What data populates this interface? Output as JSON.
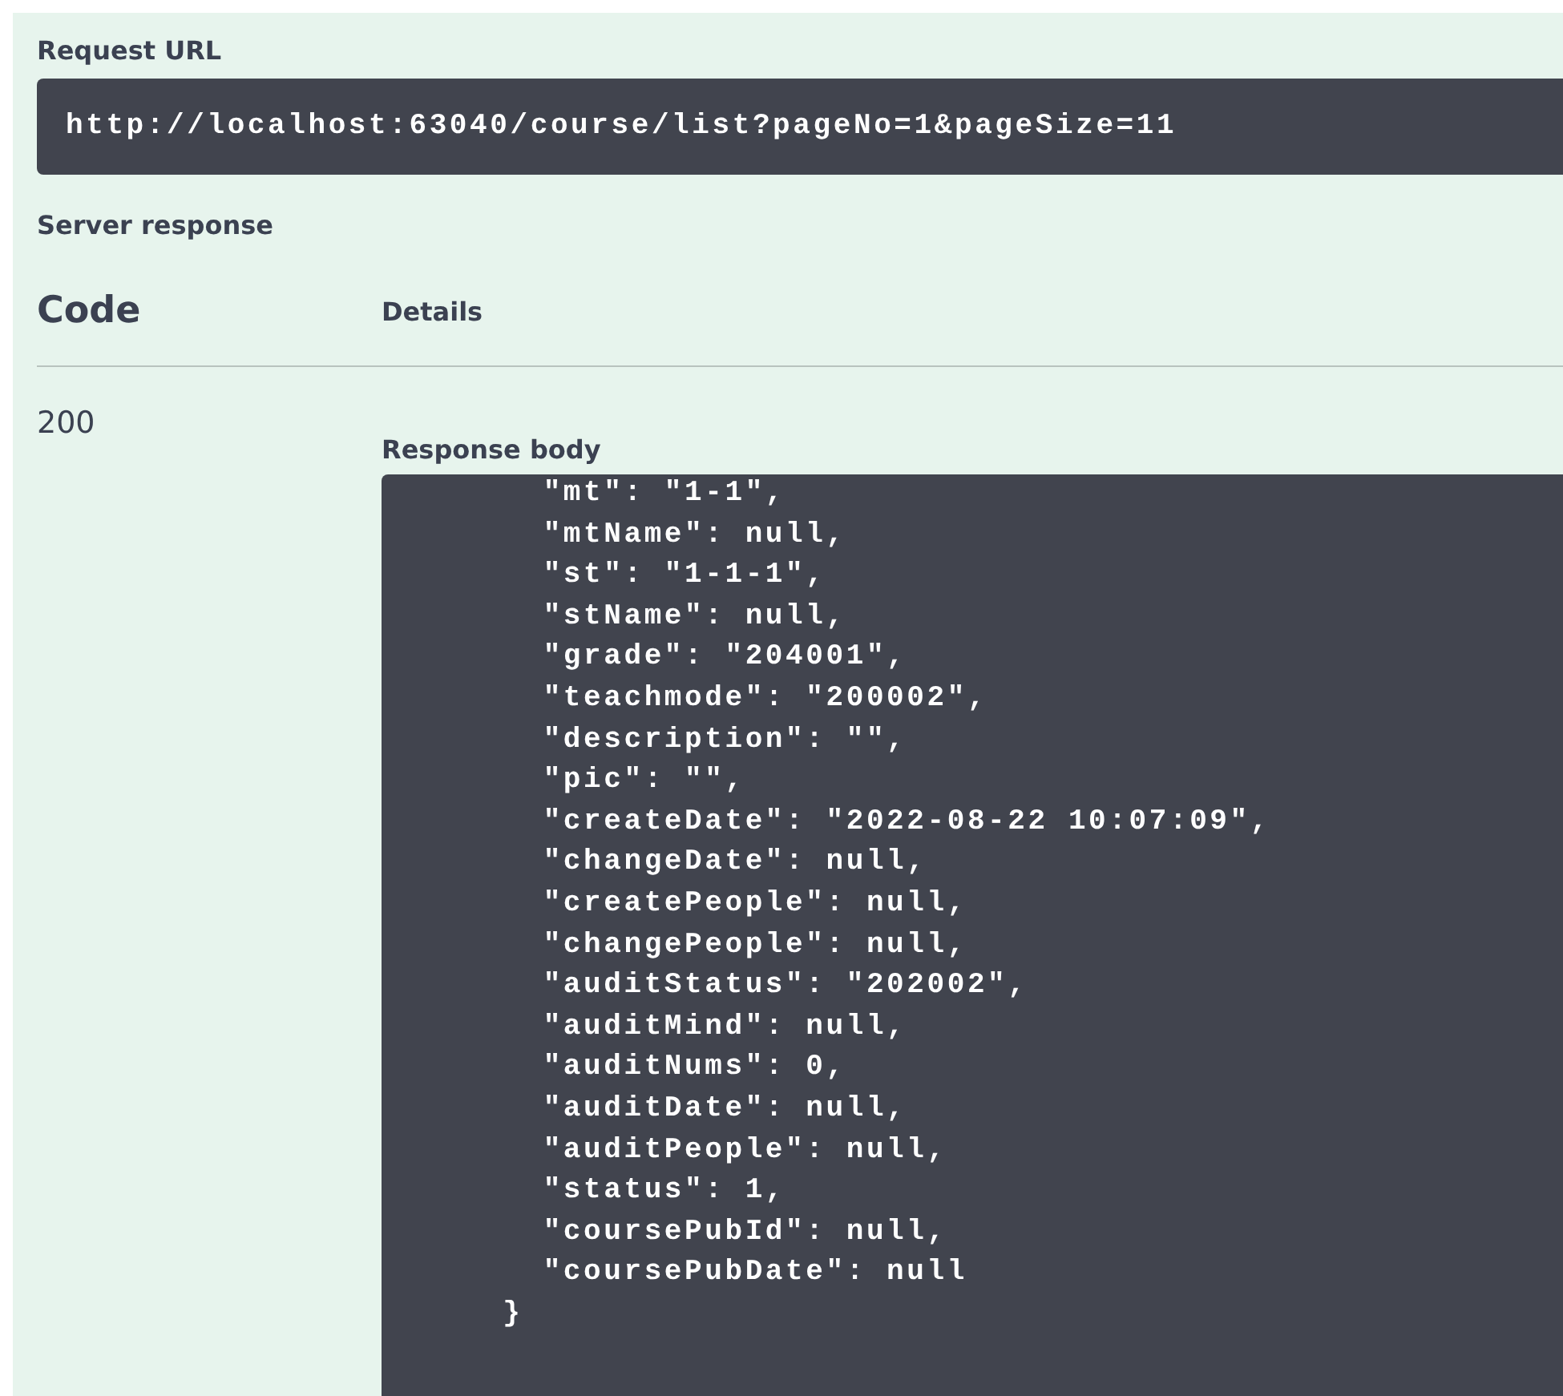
{
  "request_url": {
    "label": "Request URL",
    "url": "http://localhost:63040/course/list?pageNo=1&pageSize=11"
  },
  "server_response": {
    "label": "Server response",
    "columns": [
      "Code",
      "Details"
    ],
    "rows": [
      {
        "code": "200",
        "body_label": "Response body",
        "body_lines": [
          "        \"mt\": \"1-1\",",
          "        \"mtName\": null,",
          "        \"st\": \"1-1-1\",",
          "        \"stName\": null,",
          "        \"grade\": \"204001\",",
          "        \"teachmode\": \"200002\",",
          "        \"description\": \"\",",
          "        \"pic\": \"\",",
          "        \"createDate\": \"2022-08-22 10:07:09\",",
          "        \"changeDate\": null,",
          "        \"createPeople\": null,",
          "        \"changePeople\": null,",
          "        \"auditStatus\": \"202002\",",
          "        \"auditMind\": null,",
          "        \"auditNums\": 0,",
          "        \"auditDate\": null,",
          "        \"auditPeople\": null,",
          "        \"status\": 1,",
          "        \"coursePubId\": null,",
          "        \"coursePubDate\": null",
          "      }"
        ]
      }
    ]
  }
}
